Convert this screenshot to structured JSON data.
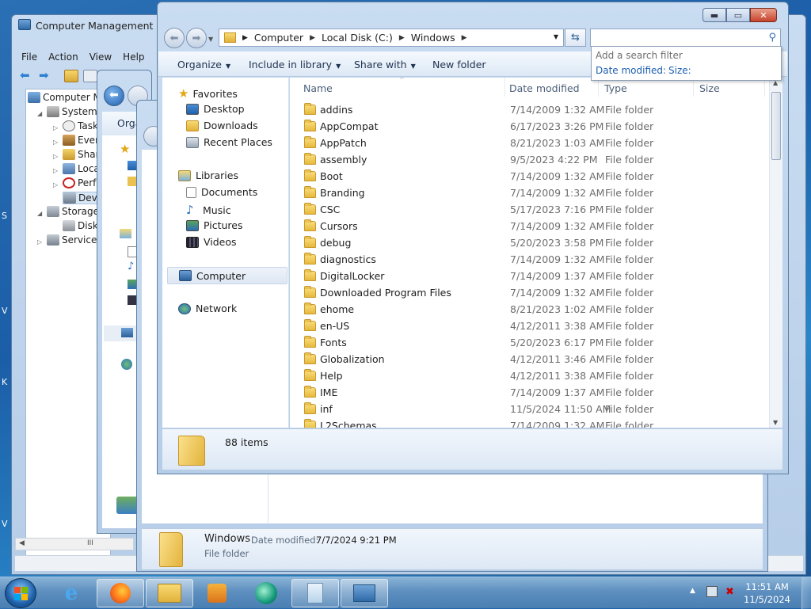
{
  "desktop": {
    "edge_chars": [
      "S",
      "V",
      "K",
      "V"
    ]
  },
  "computer_management": {
    "title": "Computer Management",
    "menu": [
      "File",
      "Action",
      "View",
      "Help"
    ],
    "tree": [
      {
        "label": "Computer Ma",
        "icon": "computer-icon"
      },
      {
        "label": "System To",
        "icon": "tools-icon"
      },
      {
        "label": "Task Sc",
        "icon": "clock-icon"
      },
      {
        "label": "Event V",
        "icon": "event-viewer-icon"
      },
      {
        "label": "Shared",
        "icon": "shared-folder-icon"
      },
      {
        "label": "Local U",
        "icon": "users-icon"
      },
      {
        "label": "Perforr",
        "icon": "performance-icon"
      },
      {
        "label": "Device",
        "icon": "device-manager-icon"
      },
      {
        "label": "Storage",
        "icon": "storage-icon"
      },
      {
        "label": "Disk M",
        "icon": "disk-icon"
      },
      {
        "label": "Services ar",
        "icon": "services-icon"
      }
    ],
    "scroll_grip": "III"
  },
  "explorer_back": {
    "org_label": "Orga"
  },
  "explorer_middle": {
    "details_name": "Windows",
    "details_modified_label": "Date modified:",
    "details_modified_value": "7/7/2024 9:21 PM",
    "details_type": "File folder"
  },
  "explorer": {
    "window_buttons": {
      "minimize": "▬",
      "maximize": "▭",
      "close": "✕"
    },
    "breadcrumb": [
      "Computer",
      "Local Disk (C:)",
      "Windows"
    ],
    "search_placeholder": "",
    "commands": {
      "organize": "Organize",
      "include": "Include in library",
      "share": "Share with",
      "new_folder": "New folder"
    },
    "filter": {
      "prompt": "Add a search filter",
      "date": "Date modified:",
      "size": "Size:"
    },
    "nav": {
      "favorites": "Favorites",
      "desktop": "Desktop",
      "downloads": "Downloads",
      "recent": "Recent Places",
      "libraries": "Libraries",
      "documents": "Documents",
      "music": "Music",
      "pictures": "Pictures",
      "videos": "Videos",
      "computer": "Computer",
      "network": "Network"
    },
    "columns": {
      "name": "Name",
      "date": "Date modified",
      "type": "Type",
      "size": "Size"
    },
    "files": [
      {
        "name": "addins",
        "date": "7/14/2009 1:32 AM",
        "type": "File folder"
      },
      {
        "name": "AppCompat",
        "date": "6/17/2023 3:26 PM",
        "type": "File folder"
      },
      {
        "name": "AppPatch",
        "date": "8/21/2023 1:03 AM",
        "type": "File folder"
      },
      {
        "name": "assembly",
        "date": "9/5/2023 4:22 PM",
        "type": "File folder"
      },
      {
        "name": "Boot",
        "date": "7/14/2009 1:32 AM",
        "type": "File folder"
      },
      {
        "name": "Branding",
        "date": "7/14/2009 1:32 AM",
        "type": "File folder"
      },
      {
        "name": "CSC",
        "date": "5/17/2023 7:16 PM",
        "type": "File folder"
      },
      {
        "name": "Cursors",
        "date": "7/14/2009 1:32 AM",
        "type": "File folder"
      },
      {
        "name": "debug",
        "date": "5/20/2023 3:58 PM",
        "type": "File folder"
      },
      {
        "name": "diagnostics",
        "date": "7/14/2009 1:32 AM",
        "type": "File folder"
      },
      {
        "name": "DigitalLocker",
        "date": "7/14/2009 1:37 AM",
        "type": "File folder"
      },
      {
        "name": "Downloaded Program Files",
        "date": "7/14/2009 1:32 AM",
        "type": "File folder"
      },
      {
        "name": "ehome",
        "date": "8/21/2023 1:02 AM",
        "type": "File folder"
      },
      {
        "name": "en-US",
        "date": "4/12/2011 3:38 AM",
        "type": "File folder"
      },
      {
        "name": "Fonts",
        "date": "5/20/2023 6:17 PM",
        "type": "File folder"
      },
      {
        "name": "Globalization",
        "date": "4/12/2011 3:46 AM",
        "type": "File folder"
      },
      {
        "name": "Help",
        "date": "4/12/2011 3:38 AM",
        "type": "File folder"
      },
      {
        "name": "IME",
        "date": "7/14/2009 1:37 AM",
        "type": "File folder"
      },
      {
        "name": "inf",
        "date": "11/5/2024 11:50 AM",
        "type": "File folder"
      },
      {
        "name": "L2Schemas",
        "date": "7/14/2009 1:32 AM",
        "type": "File folder"
      }
    ],
    "status": "88 items"
  },
  "taskbar": {
    "items": [
      "start-orb",
      "internet-explorer",
      "firefox",
      "windows-explorer",
      "media-player",
      "app-green",
      "app-notepad",
      "computer-management"
    ],
    "time": "11:51 AM",
    "date": "11/5/2024"
  }
}
